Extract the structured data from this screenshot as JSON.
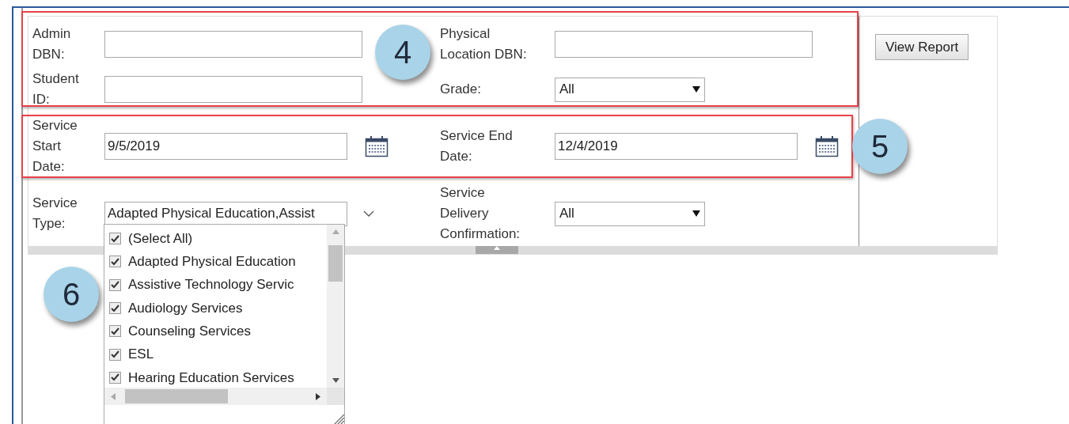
{
  "rows": [
    {
      "left": {
        "label": "Admin DBN:",
        "kind": "text"
      },
      "right": {
        "label": "Physical Location DBN:",
        "kind": "text"
      }
    },
    {
      "left": {
        "label": "Student ID:",
        "kind": "text"
      },
      "right": {
        "label": "Grade:",
        "kind": "select",
        "value": "All"
      }
    },
    {
      "left": {
        "label": "Service Start Date:",
        "kind": "date",
        "value": "9/5/2019"
      },
      "right": {
        "label": "Service End Date:",
        "kind": "date",
        "value": "12/4/2019"
      }
    },
    {
      "left": {
        "label": "Service Type:",
        "kind": "multiselect",
        "value": "Adapted Physical Education,Assist"
      },
      "right": {
        "label": "Service Delivery Confirmation:",
        "kind": "select",
        "value": "All"
      }
    }
  ],
  "view_report_button": "View Report",
  "service_type_options": [
    {
      "label": "(Select All)",
      "checked": true
    },
    {
      "label": "Adapted Physical Education",
      "checked": true
    },
    {
      "label": "Assistive Technology Servic",
      "checked": true
    },
    {
      "label": "Audiology Services",
      "checked": true
    },
    {
      "label": "Counseling Services",
      "checked": true
    },
    {
      "label": "ESL",
      "checked": true
    },
    {
      "label": "Hearing Education Services",
      "checked": true
    }
  ],
  "callouts": [
    "4",
    "5",
    "6"
  ]
}
